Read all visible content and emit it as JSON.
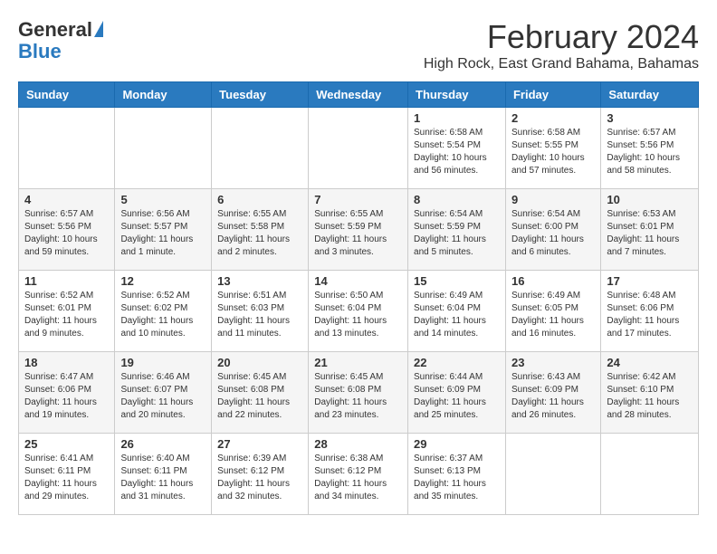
{
  "header": {
    "logo_general": "General",
    "logo_blue": "Blue",
    "month_year": "February 2024",
    "location": "High Rock, East Grand Bahama, Bahamas"
  },
  "columns": [
    "Sunday",
    "Monday",
    "Tuesday",
    "Wednesday",
    "Thursday",
    "Friday",
    "Saturday"
  ],
  "weeks": [
    [
      {
        "day": "",
        "info": ""
      },
      {
        "day": "",
        "info": ""
      },
      {
        "day": "",
        "info": ""
      },
      {
        "day": "",
        "info": ""
      },
      {
        "day": "1",
        "info": "Sunrise: 6:58 AM\nSunset: 5:54 PM\nDaylight: 10 hours and 56 minutes."
      },
      {
        "day": "2",
        "info": "Sunrise: 6:58 AM\nSunset: 5:55 PM\nDaylight: 10 hours and 57 minutes."
      },
      {
        "day": "3",
        "info": "Sunrise: 6:57 AM\nSunset: 5:56 PM\nDaylight: 10 hours and 58 minutes."
      }
    ],
    [
      {
        "day": "4",
        "info": "Sunrise: 6:57 AM\nSunset: 5:56 PM\nDaylight: 10 hours and 59 minutes."
      },
      {
        "day": "5",
        "info": "Sunrise: 6:56 AM\nSunset: 5:57 PM\nDaylight: 11 hours and 1 minute."
      },
      {
        "day": "6",
        "info": "Sunrise: 6:55 AM\nSunset: 5:58 PM\nDaylight: 11 hours and 2 minutes."
      },
      {
        "day": "7",
        "info": "Sunrise: 6:55 AM\nSunset: 5:59 PM\nDaylight: 11 hours and 3 minutes."
      },
      {
        "day": "8",
        "info": "Sunrise: 6:54 AM\nSunset: 5:59 PM\nDaylight: 11 hours and 5 minutes."
      },
      {
        "day": "9",
        "info": "Sunrise: 6:54 AM\nSunset: 6:00 PM\nDaylight: 11 hours and 6 minutes."
      },
      {
        "day": "10",
        "info": "Sunrise: 6:53 AM\nSunset: 6:01 PM\nDaylight: 11 hours and 7 minutes."
      }
    ],
    [
      {
        "day": "11",
        "info": "Sunrise: 6:52 AM\nSunset: 6:01 PM\nDaylight: 11 hours and 9 minutes."
      },
      {
        "day": "12",
        "info": "Sunrise: 6:52 AM\nSunset: 6:02 PM\nDaylight: 11 hours and 10 minutes."
      },
      {
        "day": "13",
        "info": "Sunrise: 6:51 AM\nSunset: 6:03 PM\nDaylight: 11 hours and 11 minutes."
      },
      {
        "day": "14",
        "info": "Sunrise: 6:50 AM\nSunset: 6:04 PM\nDaylight: 11 hours and 13 minutes."
      },
      {
        "day": "15",
        "info": "Sunrise: 6:49 AM\nSunset: 6:04 PM\nDaylight: 11 hours and 14 minutes."
      },
      {
        "day": "16",
        "info": "Sunrise: 6:49 AM\nSunset: 6:05 PM\nDaylight: 11 hours and 16 minutes."
      },
      {
        "day": "17",
        "info": "Sunrise: 6:48 AM\nSunset: 6:06 PM\nDaylight: 11 hours and 17 minutes."
      }
    ],
    [
      {
        "day": "18",
        "info": "Sunrise: 6:47 AM\nSunset: 6:06 PM\nDaylight: 11 hours and 19 minutes."
      },
      {
        "day": "19",
        "info": "Sunrise: 6:46 AM\nSunset: 6:07 PM\nDaylight: 11 hours and 20 minutes."
      },
      {
        "day": "20",
        "info": "Sunrise: 6:45 AM\nSunset: 6:08 PM\nDaylight: 11 hours and 22 minutes."
      },
      {
        "day": "21",
        "info": "Sunrise: 6:45 AM\nSunset: 6:08 PM\nDaylight: 11 hours and 23 minutes."
      },
      {
        "day": "22",
        "info": "Sunrise: 6:44 AM\nSunset: 6:09 PM\nDaylight: 11 hours and 25 minutes."
      },
      {
        "day": "23",
        "info": "Sunrise: 6:43 AM\nSunset: 6:09 PM\nDaylight: 11 hours and 26 minutes."
      },
      {
        "day": "24",
        "info": "Sunrise: 6:42 AM\nSunset: 6:10 PM\nDaylight: 11 hours and 28 minutes."
      }
    ],
    [
      {
        "day": "25",
        "info": "Sunrise: 6:41 AM\nSunset: 6:11 PM\nDaylight: 11 hours and 29 minutes."
      },
      {
        "day": "26",
        "info": "Sunrise: 6:40 AM\nSunset: 6:11 PM\nDaylight: 11 hours and 31 minutes."
      },
      {
        "day": "27",
        "info": "Sunrise: 6:39 AM\nSunset: 6:12 PM\nDaylight: 11 hours and 32 minutes."
      },
      {
        "day": "28",
        "info": "Sunrise: 6:38 AM\nSunset: 6:12 PM\nDaylight: 11 hours and 34 minutes."
      },
      {
        "day": "29",
        "info": "Sunrise: 6:37 AM\nSunset: 6:13 PM\nDaylight: 11 hours and 35 minutes."
      },
      {
        "day": "",
        "info": ""
      },
      {
        "day": "",
        "info": ""
      }
    ]
  ]
}
